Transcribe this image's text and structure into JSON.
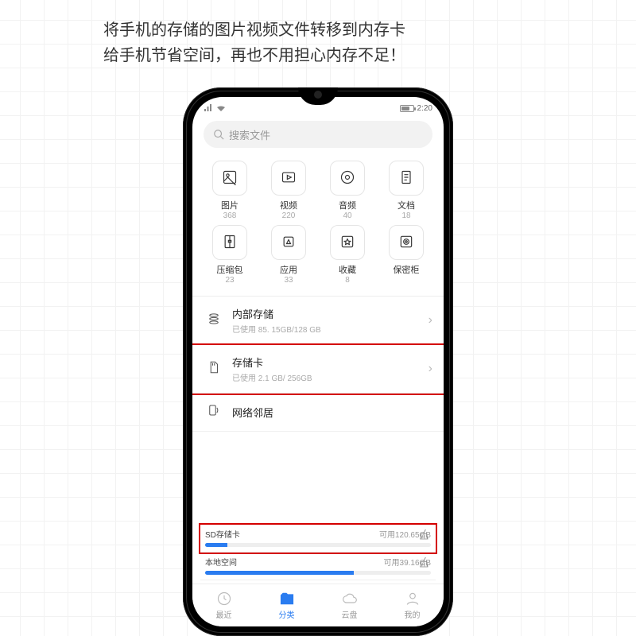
{
  "headline": {
    "line1": "将手机的存储的图片视频文件转移到内存卡",
    "line2": "给手机节省空间，再也不用担心内存不足！"
  },
  "statusbar": {
    "time": "2:20"
  },
  "search": {
    "placeholder": "搜索文件"
  },
  "categories": [
    {
      "key": "images",
      "label": "图片",
      "count": "368"
    },
    {
      "key": "video",
      "label": "视频",
      "count": "220"
    },
    {
      "key": "audio",
      "label": "音频",
      "count": "40"
    },
    {
      "key": "docs",
      "label": "文档",
      "count": "18"
    },
    {
      "key": "archives",
      "label": "压缩包",
      "count": "23"
    },
    {
      "key": "apps",
      "label": "应用",
      "count": "33"
    },
    {
      "key": "fav",
      "label": "收藏",
      "count": "8"
    },
    {
      "key": "safe",
      "label": "保密柜",
      "count": ""
    }
  ],
  "storage": {
    "internal": {
      "title": "内部存储",
      "sub": "已使用 85. 15GB/128 GB"
    },
    "sdcard": {
      "title": "存储卡",
      "sub": "已使用 2.1 GB/ 256GB"
    },
    "network": {
      "title": "网络邻居"
    }
  },
  "usage": {
    "sd": {
      "title": "SD存储卡",
      "avail": "可用120.65GB",
      "fill_pct": 10
    },
    "local": {
      "title": "本地空间",
      "avail": "可用39.16GB",
      "fill_pct": 66
    }
  },
  "nav": {
    "recent": "最近",
    "category": "分类",
    "cloud": "云盘",
    "mine": "我的"
  },
  "colors": {
    "accent": "#2a7cf0",
    "highlight": "#d40000"
  }
}
